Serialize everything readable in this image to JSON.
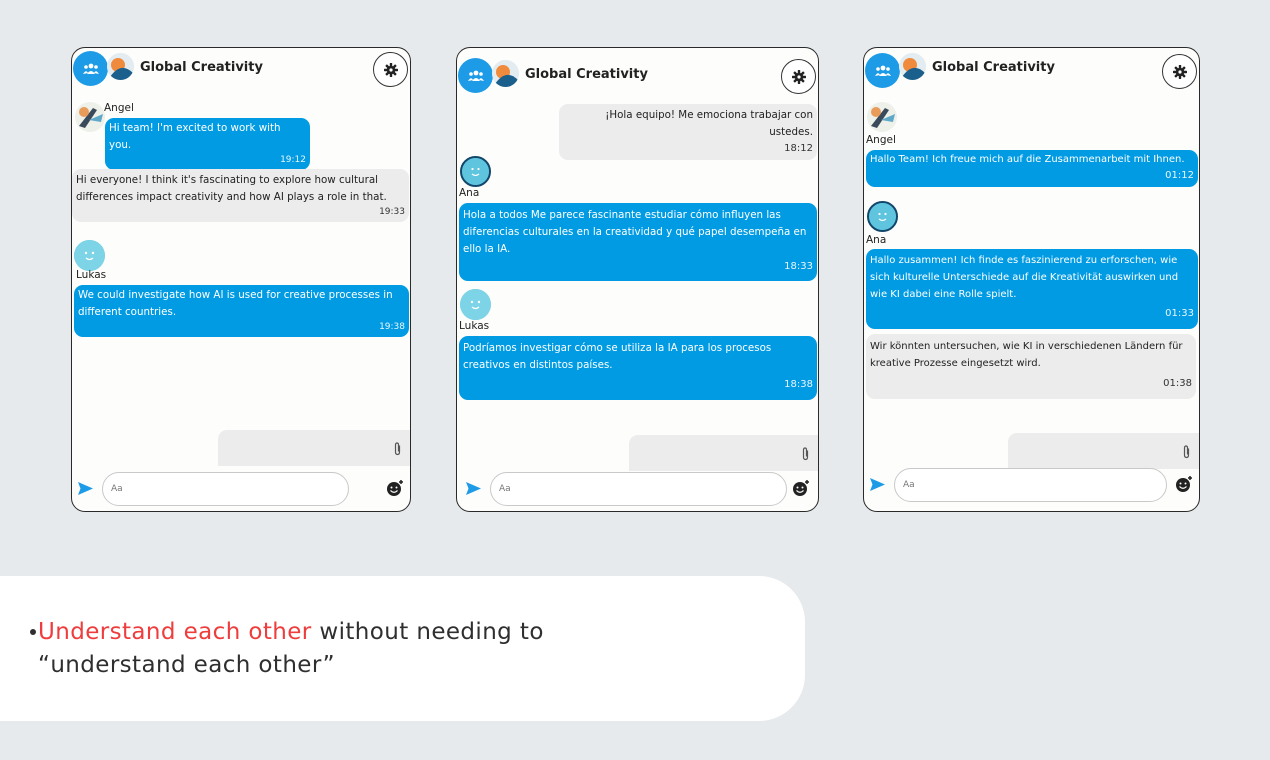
{
  "chat_title": "Global Creativity",
  "input_placeholder": "Aa",
  "panels": [
    {
      "messages": [
        {
          "sender": "Angel",
          "text": "Hi team! I'm excited to work with you.",
          "time": "19:12"
        },
        {
          "text": "Hi everyone! I think it's fascinating to explore how cultural differences impact creativity and how AI plays a role in that.",
          "time": "19:33"
        },
        {
          "sender": "Lukas",
          "text": "We could investigate how AI is used for creative processes in different countries.",
          "time": "19:38"
        }
      ]
    },
    {
      "messages": [
        {
          "text": "¡Hola equipo! Me emociona trabajar con ustedes.",
          "time": "18:12"
        },
        {
          "sender": "Ana",
          "text": "Hola a todos Me parece fascinante estudiar cómo influyen las diferencias culturales en la creatividad y qué papel desempeña en ello la IA.",
          "time": "18:33"
        },
        {
          "sender": "Lukas",
          "text": "Podríamos investigar cómo se utiliza la IA para los procesos creativos en distintos países.",
          "time": "18:38"
        }
      ]
    },
    {
      "messages": [
        {
          "sender": "Angel",
          "text": "Hallo Team! Ich freue mich auf die Zusammenarbeit mit Ihnen.",
          "time": "01:12"
        },
        {
          "sender": "Ana",
          "text": "Hallo zusammen! Ich finde es faszinierend zu erforschen, wie sich kulturelle Unterschiede auf die Kreativität auswirken und wie KI dabei eine Rolle spielt.",
          "time": "01:33"
        },
        {
          "text": "Wir könnten untersuchen, wie KI in verschiedenen Ländern für kreative Prozesse eingesetzt wird.",
          "time": "01:38"
        }
      ]
    }
  ],
  "caption": {
    "highlight": "Understand each other",
    "rest_line1": " without needing to",
    "line2": "“understand each other”"
  },
  "colors": {
    "accent": "#009be3",
    "highlight": "#ef3c3c",
    "background": "#e6eaed"
  }
}
